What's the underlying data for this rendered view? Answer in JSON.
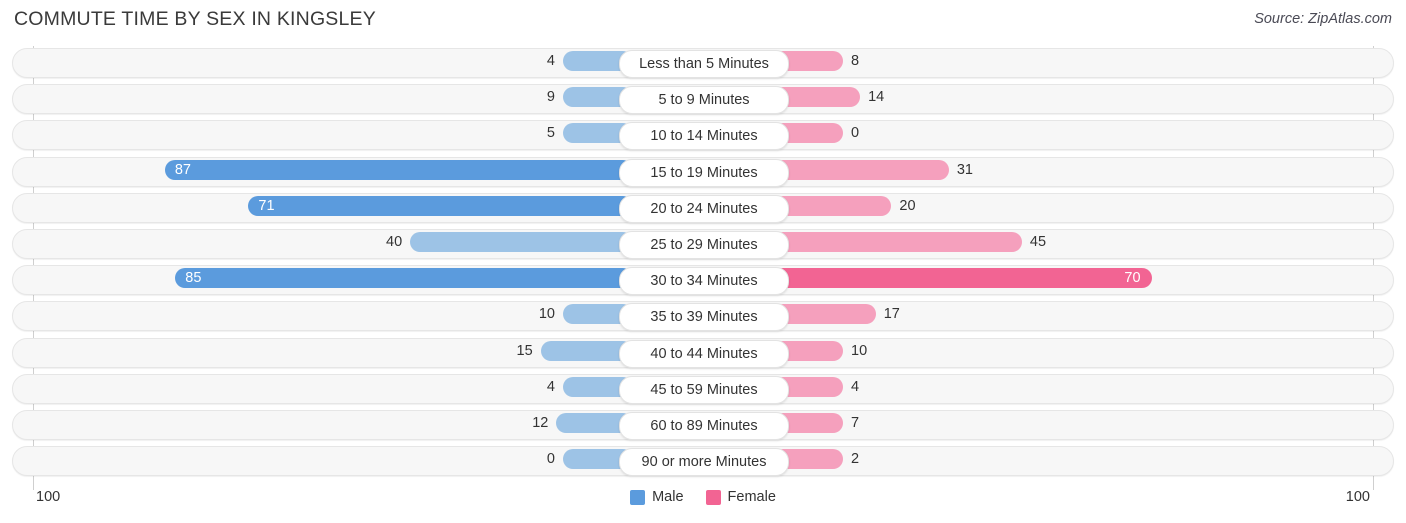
{
  "header": {
    "title": "COMMUTE TIME BY SEX IN KINGSLEY",
    "source": "Source: ZipAtlas.com"
  },
  "axis": {
    "left_tick": "100",
    "right_tick": "100",
    "max": 100
  },
  "legend": {
    "items": [
      {
        "label": "Male",
        "color": "#5b9bdd"
      },
      {
        "label": "Female",
        "color": "#f26493"
      }
    ]
  },
  "colors": {
    "male_light": "#9dc3e6",
    "male_strong": "#5b9bdd",
    "female_light": "#f5a0bd",
    "female_strong": "#f26493",
    "track": "#f7f7f7",
    "track_border": "#e6e6e6"
  },
  "chart_data": {
    "type": "bar",
    "orientation": "horizontal-diverging",
    "title": "COMMUTE TIME BY SEX IN KINGSLEY",
    "xlabel": "",
    "ylabel": "",
    "xlim": [
      100,
      100
    ],
    "grid": false,
    "legend_position": "bottom-center",
    "categories": [
      "Less than 5 Minutes",
      "5 to 9 Minutes",
      "10 to 14 Minutes",
      "15 to 19 Minutes",
      "20 to 24 Minutes",
      "25 to 29 Minutes",
      "30 to 34 Minutes",
      "35 to 39 Minutes",
      "40 to 44 Minutes",
      "45 to 59 Minutes",
      "60 to 89 Minutes",
      "90 or more Minutes"
    ],
    "series": [
      {
        "name": "Male",
        "values": [
          4,
          9,
          5,
          87,
          71,
          40,
          85,
          10,
          15,
          4,
          12,
          0
        ]
      },
      {
        "name": "Female",
        "values": [
          8,
          14,
          0,
          31,
          20,
          45,
          70,
          17,
          10,
          4,
          7,
          2
        ]
      }
    ]
  },
  "rows": [
    {
      "label": "Less than 5 Minutes",
      "male": "4",
      "female": "8"
    },
    {
      "label": "5 to 9 Minutes",
      "male": "9",
      "female": "14"
    },
    {
      "label": "10 to 14 Minutes",
      "male": "5",
      "female": "0"
    },
    {
      "label": "15 to 19 Minutes",
      "male": "87",
      "female": "31"
    },
    {
      "label": "20 to 24 Minutes",
      "male": "71",
      "female": "20"
    },
    {
      "label": "25 to 29 Minutes",
      "male": "40",
      "female": "45"
    },
    {
      "label": "30 to 34 Minutes",
      "male": "85",
      "female": "70"
    },
    {
      "label": "35 to 39 Minutes",
      "male": "10",
      "female": "17"
    },
    {
      "label": "40 to 44 Minutes",
      "male": "15",
      "female": "10"
    },
    {
      "label": "45 to 59 Minutes",
      "male": "4",
      "female": "4"
    },
    {
      "label": "60 to 89 Minutes",
      "male": "12",
      "female": "7"
    },
    {
      "label": "90 or more Minutes",
      "male": "0",
      "female": "2"
    }
  ]
}
